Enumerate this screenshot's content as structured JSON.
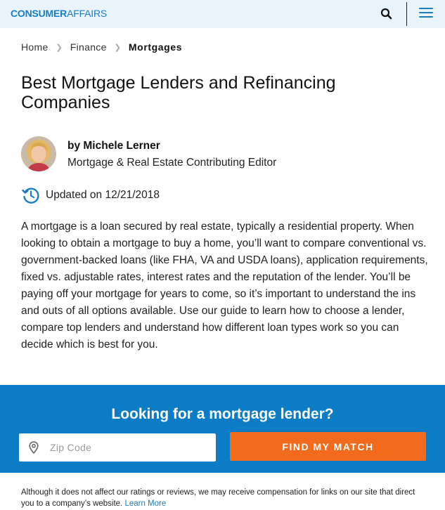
{
  "header": {
    "logo_bold": "CONSUMER",
    "logo_light": "AFFAIRS",
    "icons": {
      "search": "search-icon",
      "menu": "hamburger-menu-icon"
    },
    "brand_color": "#1a7cc1"
  },
  "breadcrumb": {
    "items": [
      "Home",
      "Finance"
    ],
    "current": "Mortgages"
  },
  "article": {
    "title": "Best Mortgage Lenders and Refinancing Companies",
    "author_name": "by Michele Lerner",
    "author_role": "Mortgage & Real Estate Contributing Editor",
    "updated": "Updated on 12/21/2018",
    "intro": "A mortgage is a loan secured by real estate, typically a residential property. When looking to obtain a mortgage to buy a home, you’ll want to compare conventional vs. government-backed loans (like FHA, VA and USDA loans), application requirements, fixed vs. adjustable rates, interest rates and the reputation of the lender. You’ll be paying off your mortgage for years to come, so it’s important to understand the ins and outs of all options available. Use our guide to learn how to choose a lender, compare top lenders and understand how different loan types work so you can decide which is best for you."
  },
  "cta": {
    "title": "Looking for a mortgage lender?",
    "zip_placeholder": "Zip Code",
    "zip_value": "",
    "button_label": "FIND MY MATCH",
    "background_color": "#0b7cc5",
    "button_color": "#f26a1b"
  },
  "disclosure": {
    "text": "Although it does not affect our ratings or reviews, we may receive compensation for links on our site that direct you to a company’s website. ",
    "link_label": "Learn More"
  }
}
